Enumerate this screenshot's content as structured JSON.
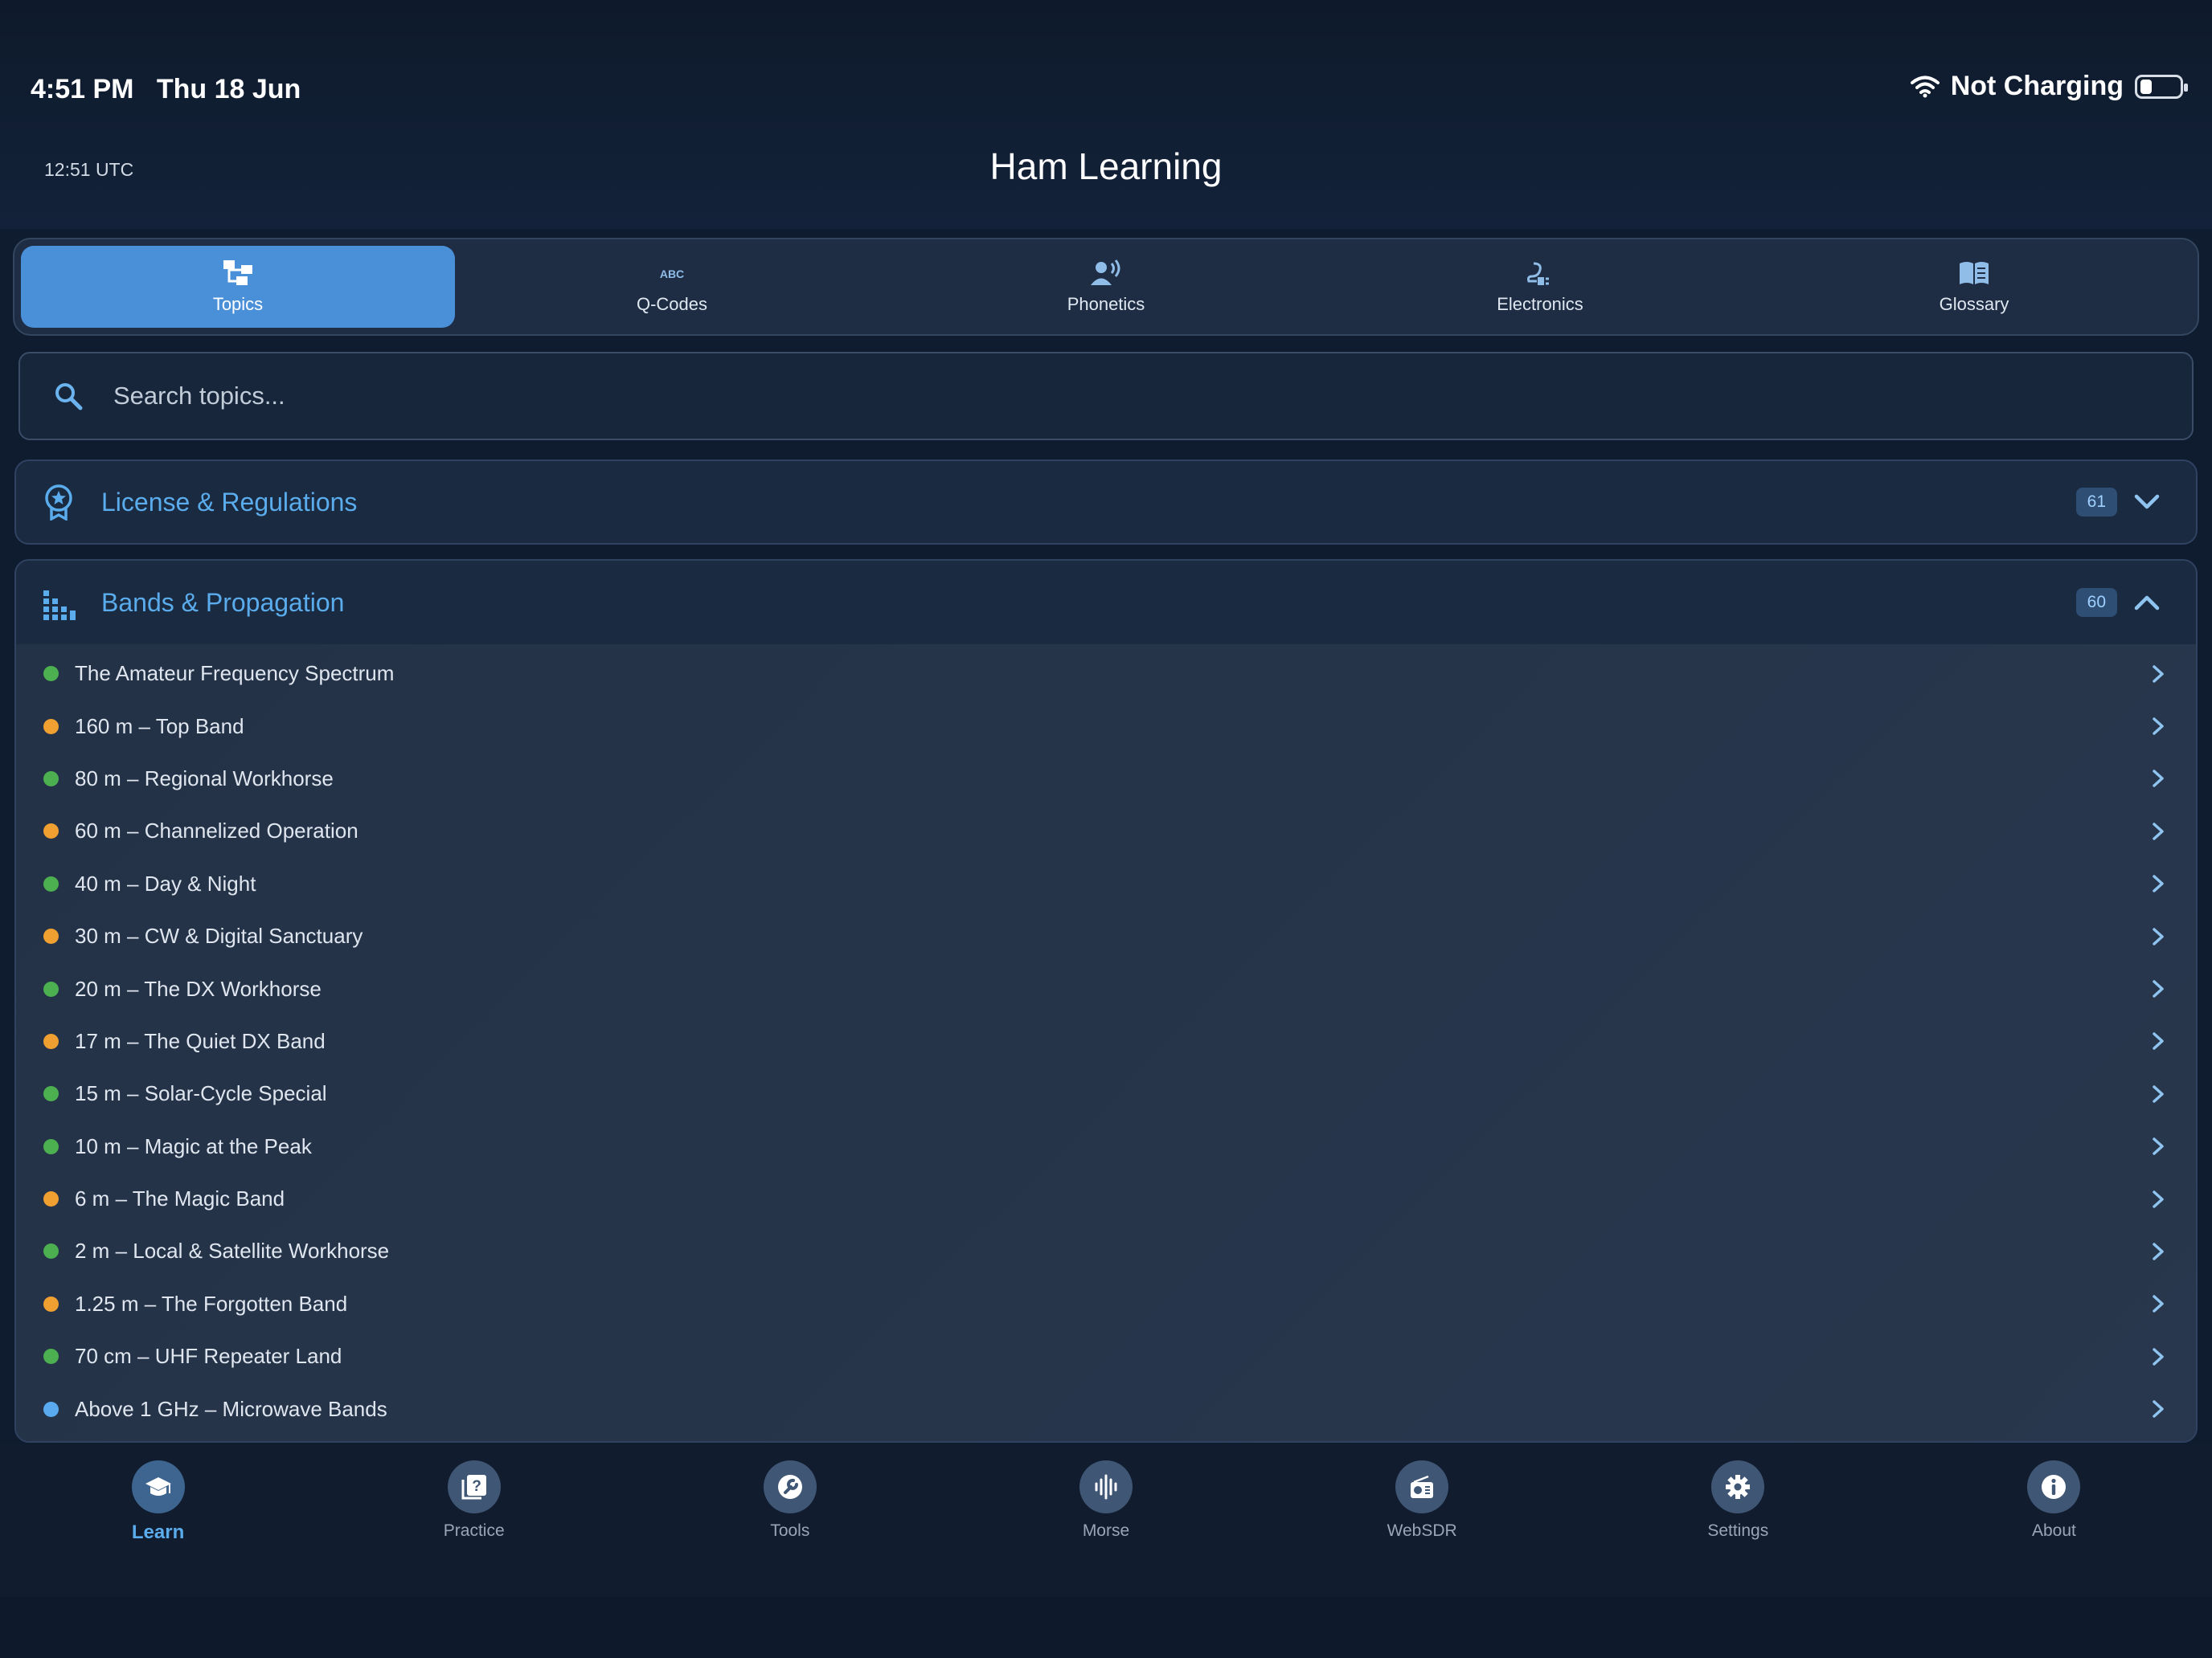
{
  "status_bar": {
    "time": "4:51 PM",
    "date": "Thu 18 Jun",
    "wifi_icon": "wifi-icon",
    "battery_text": "Not Charging"
  },
  "header": {
    "utc": "12:51 UTC",
    "title": "Ham Learning"
  },
  "tabs": [
    {
      "label": "Topics",
      "icon": "topics-icon",
      "active": true
    },
    {
      "label": "Q-Codes",
      "icon": "abc-icon",
      "active": false
    },
    {
      "label": "Phonetics",
      "icon": "speaker-person-icon",
      "active": false
    },
    {
      "label": "Electronics",
      "icon": "circuit-icon",
      "active": false
    },
    {
      "label": "Glossary",
      "icon": "book-icon",
      "active": false
    }
  ],
  "search": {
    "placeholder": "Search topics..."
  },
  "sections": [
    {
      "title": "License & Regulations",
      "count": "61",
      "expanded": false,
      "icon": "award-icon"
    },
    {
      "title": "Bands & Propagation",
      "count": "60",
      "expanded": true,
      "icon": "bars-icon",
      "items": [
        {
          "label": "The Amateur Frequency Spectrum",
          "status": "green"
        },
        {
          "label": "160 m – Top Band",
          "status": "orange"
        },
        {
          "label": "80 m – Regional Workhorse",
          "status": "green"
        },
        {
          "label": "60 m – Channelized Operation",
          "status": "orange"
        },
        {
          "label": "40 m – Day & Night",
          "status": "green"
        },
        {
          "label": "30 m – CW & Digital Sanctuary",
          "status": "orange"
        },
        {
          "label": "20 m – The DX Workhorse",
          "status": "green"
        },
        {
          "label": "17 m – The Quiet DX Band",
          "status": "orange"
        },
        {
          "label": "15 m – Solar-Cycle Special",
          "status": "green"
        },
        {
          "label": "10 m – Magic at the Peak",
          "status": "green"
        },
        {
          "label": "6 m – The Magic Band",
          "status": "orange"
        },
        {
          "label": "2 m – Local & Satellite Workhorse",
          "status": "green"
        },
        {
          "label": "1.25 m – The Forgotten Band",
          "status": "orange"
        },
        {
          "label": "70 cm – UHF Repeater Land",
          "status": "green"
        },
        {
          "label": "Above 1 GHz – Microwave Bands",
          "status": "blue"
        }
      ]
    }
  ],
  "status_colors": {
    "green": "#4caf50",
    "orange": "#f0a030",
    "blue": "#5aaaf0"
  },
  "bottom_nav": [
    {
      "label": "Learn",
      "icon": "graduation-cap-icon",
      "active": true
    },
    {
      "label": "Practice",
      "icon": "question-cards-icon",
      "active": false
    },
    {
      "label": "Tools",
      "icon": "wrench-icon",
      "active": false
    },
    {
      "label": "Morse",
      "icon": "waveform-icon",
      "active": false
    },
    {
      "label": "WebSDR",
      "icon": "radio-icon",
      "active": false
    },
    {
      "label": "Settings",
      "icon": "gear-icon",
      "active": false
    },
    {
      "label": "About",
      "icon": "info-icon",
      "active": false
    }
  ]
}
